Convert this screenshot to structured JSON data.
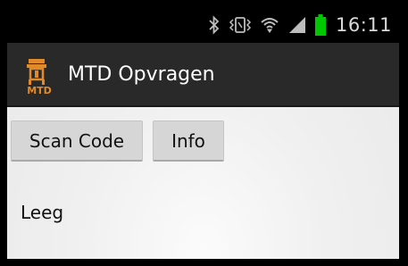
{
  "status_bar": {
    "time": "16:11",
    "icons": [
      "bluetooth-icon",
      "vibrate-icon",
      "wifi-icon",
      "signal-icon",
      "battery-icon"
    ],
    "battery_color": "#00c800"
  },
  "action_bar": {
    "title": "MTD Opvragen",
    "logo_text": "MTD",
    "accent_color": "#e08a2a"
  },
  "main": {
    "scan_button_label": "Scan Code",
    "info_button_label": "Info",
    "result_text": "Leeg"
  }
}
